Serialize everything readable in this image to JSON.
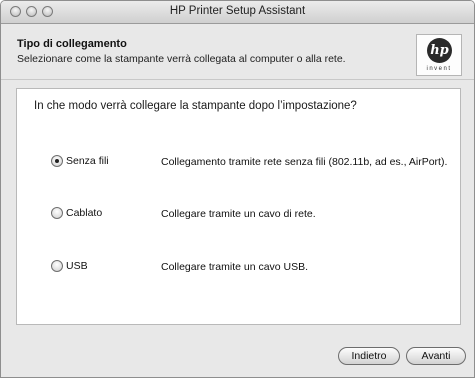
{
  "window": {
    "title": "HP Printer Setup Assistant"
  },
  "header": {
    "title": "Tipo di collegamento",
    "subtitle": "Selezionare come la stampante verrà collegata al computer o alla rete.",
    "logo_text": "hp",
    "logo_tagline": "invent"
  },
  "panel": {
    "question": "In che modo verrà collegare la stampante dopo l’impostazione?",
    "options": [
      {
        "label": "Senza fili",
        "description": "Collegamento tramite rete senza fili (802.11b, ad es., AirPort).",
        "selected": true
      },
      {
        "label": "Cablato",
        "description": "Collegare tramite un cavo di rete.",
        "selected": false
      },
      {
        "label": "USB",
        "description": "Collegare tramite un cavo USB.",
        "selected": false
      }
    ]
  },
  "buttons": {
    "back": "Indietro",
    "next": "Avanti"
  }
}
